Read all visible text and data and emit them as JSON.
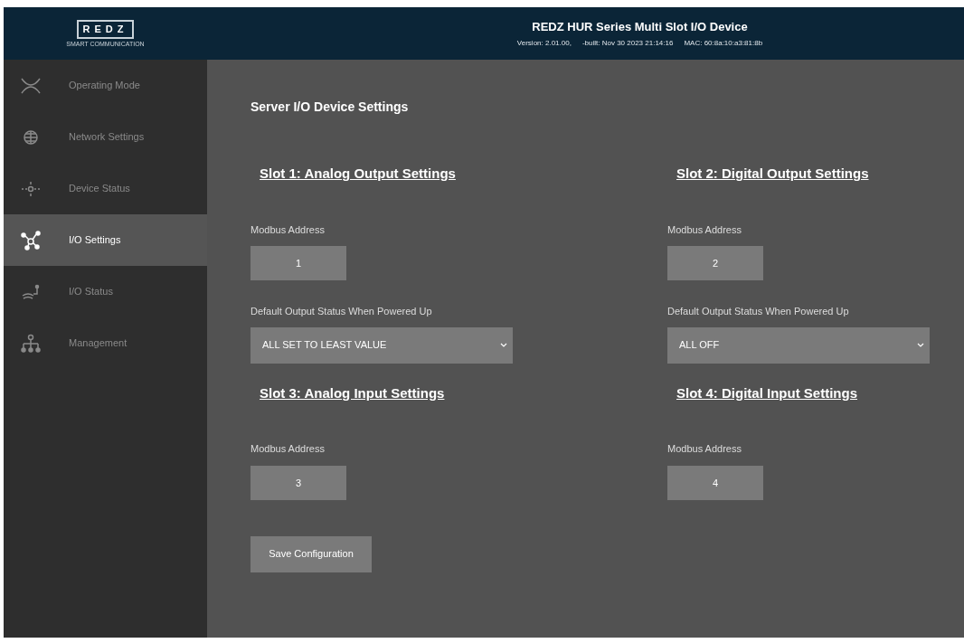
{
  "header": {
    "logo": "REDZ",
    "tagline": "SMART COMMUNICATION",
    "title": "REDZ HUR Series Multi Slot I/O Device",
    "version": "Version: 2.01.00,",
    "built": "-built: Nov 30 2023 21:14:16",
    "mac": "MAC: 60:8a:10:a3:81:8b"
  },
  "sidebar": {
    "items": [
      {
        "label": "Operating Mode",
        "selected": false
      },
      {
        "label": "Network Settings",
        "selected": false
      },
      {
        "label": "Device Status",
        "selected": false
      },
      {
        "label": "I/O Settings",
        "selected": true
      },
      {
        "label": "I/O Status",
        "selected": false
      },
      {
        "label": "Management",
        "selected": false
      }
    ]
  },
  "main": {
    "title": "Server I/O Device Settings",
    "slots": [
      {
        "kind": "output",
        "heading": "Slot 1: Analog Output Settings",
        "address_label": "Modbus Address",
        "address": "1",
        "default_label": "Default Output Status When Powered Up",
        "default_value": "ALL SET TO LEAST VALUE"
      },
      {
        "kind": "output",
        "heading": "Slot 2: Digital Output Settings",
        "address_label": "Modbus Address",
        "address": "2",
        "default_label": "Default Output Status When Powered Up",
        "default_value": "ALL OFF"
      },
      {
        "kind": "input",
        "heading": "Slot 3: Analog Input Settings",
        "address_label": "Modbus Address",
        "address": "3"
      },
      {
        "kind": "input",
        "heading": "Slot 4: Digital Input Settings",
        "address_label": "Modbus Address",
        "address": "4"
      }
    ],
    "save_button": "Save Configuration"
  }
}
